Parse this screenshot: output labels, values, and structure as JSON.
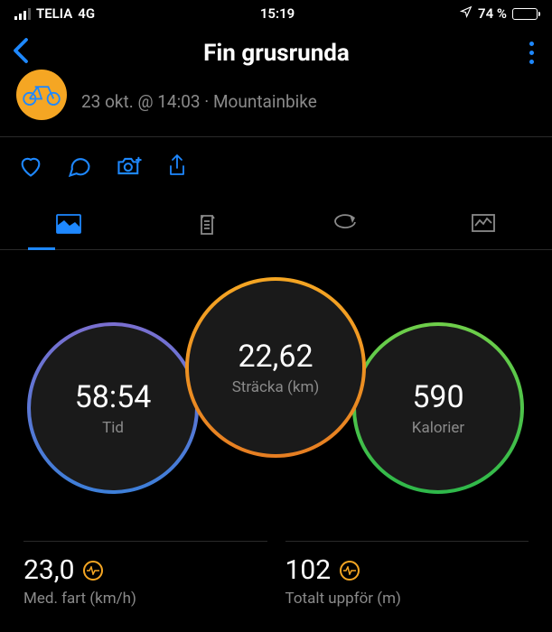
{
  "statusBar": {
    "carrier": "TELIA",
    "network": "4G",
    "time": "15:19",
    "batteryPercent": "74 %"
  },
  "nav": {
    "title": "Fin grusrunda"
  },
  "activity": {
    "meta": "23 okt. @ 14:03 · Mountainbike"
  },
  "gauges": {
    "time": {
      "value": "58:54",
      "label": "Tid"
    },
    "distance": {
      "value": "22,62",
      "label": "Sträcka (km)"
    },
    "calories": {
      "value": "590",
      "label": "Kalorier"
    }
  },
  "stats": {
    "avgSpeed": {
      "value": "23,0",
      "label": "Med. fart (km/h)"
    },
    "ascent": {
      "value": "102",
      "label": "Totalt uppför (m)"
    }
  }
}
